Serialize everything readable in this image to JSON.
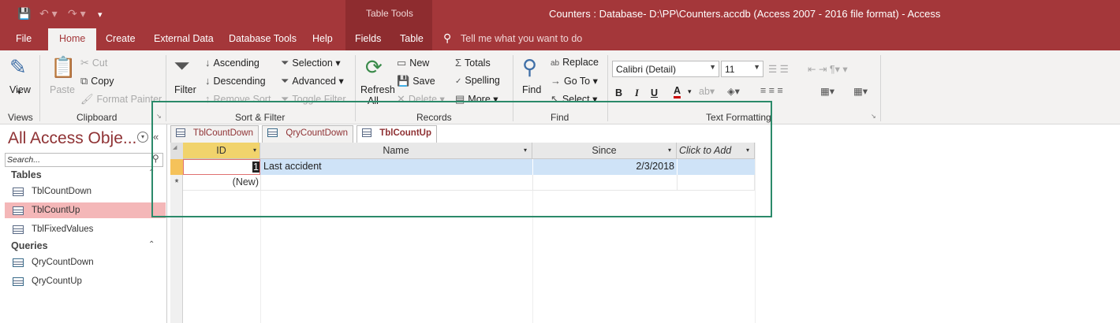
{
  "window": {
    "title": "Counters : Database- D:\\PP\\Counters.accdb (Access 2007 - 2016 file format)  -  Access",
    "contextual_group": "Table Tools"
  },
  "tabs": [
    "File",
    "Home",
    "Create",
    "External Data",
    "Database Tools",
    "Help",
    "Fields",
    "Table"
  ],
  "tell_me": "Tell me what you want to do",
  "ribbon": {
    "views": {
      "view_label": "View",
      "group": "Views"
    },
    "clipboard": {
      "paste": "Paste",
      "cut": "Cut",
      "copy": "Copy",
      "format_painter": "Format Painter",
      "group": "Clipboard"
    },
    "sort_filter": {
      "filter": "Filter",
      "ascending": "Ascending",
      "descending": "Descending",
      "remove_sort": "Remove Sort",
      "selection": "Selection",
      "advanced": "Advanced",
      "toggle_filter": "Toggle Filter",
      "group": "Sort & Filter"
    },
    "records": {
      "refresh": "Refresh",
      "refresh_all": "All",
      "new": "New",
      "save": "Save",
      "delete": "Delete",
      "totals": "Totals",
      "spelling": "Spelling",
      "more": "More",
      "group": "Records"
    },
    "find": {
      "find": "Find",
      "replace": "Replace",
      "go_to": "Go To",
      "select": "Select",
      "group": "Find"
    },
    "text_formatting": {
      "font": "Calibri (Detail)",
      "size": "11",
      "bold": "B",
      "italic": "I",
      "underline": "U",
      "group": "Text Formatting"
    }
  },
  "nav": {
    "title": "All Access Obje...",
    "search_placeholder": "Search...",
    "tables_header": "Tables",
    "tables": [
      "TblCountDown",
      "TblCountUp",
      "TblFixedValues"
    ],
    "queries_header": "Queries",
    "queries": [
      "QryCountDown",
      "QryCountUp"
    ]
  },
  "doc_tabs": [
    "TblCountDown",
    "QryCountDown",
    "TblCountUp"
  ],
  "grid": {
    "columns": [
      "ID",
      "Name",
      "Since",
      "Click to Add"
    ],
    "rows": [
      {
        "id": "1",
        "name": "Last accident",
        "since": "2/3/2018"
      }
    ],
    "new_row": "(New)",
    "new_marker": "*"
  },
  "colors": {
    "brand": "#a4373a",
    "highlight_frame": "#2b8a6a",
    "selected_row": "#cfe3f7"
  }
}
